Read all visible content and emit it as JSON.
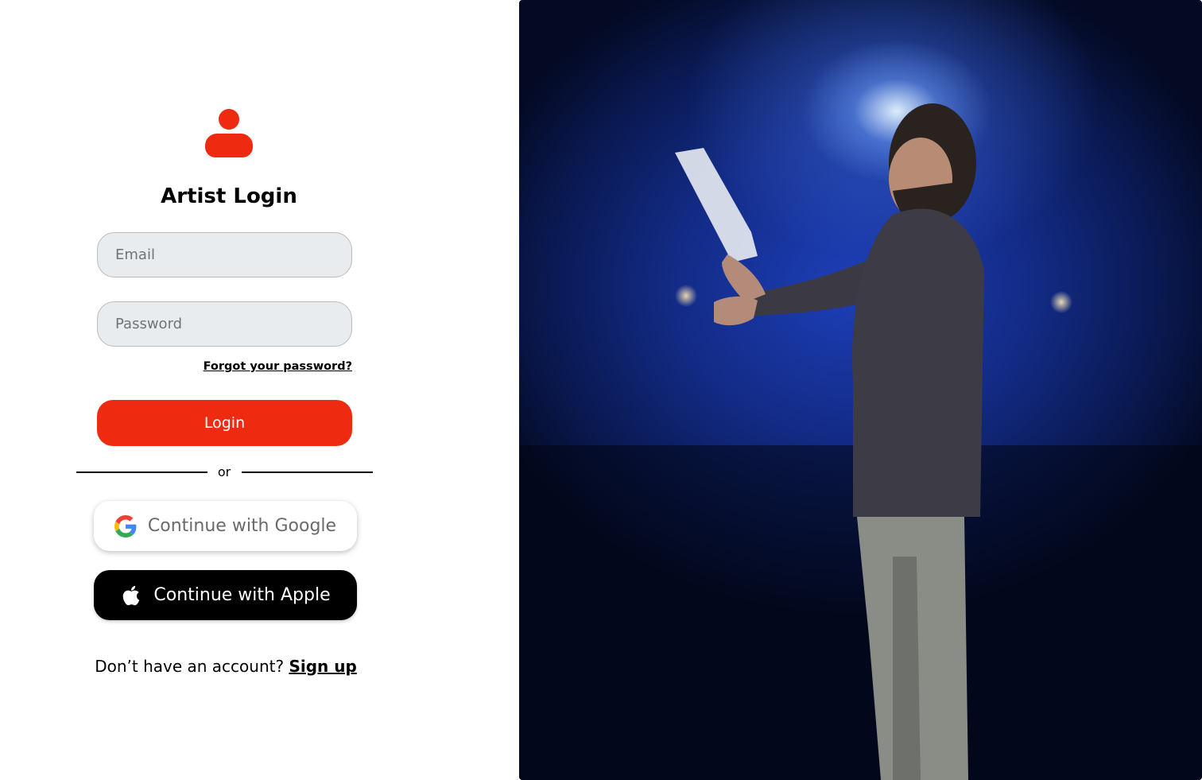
{
  "colors": {
    "accent": "#ee2a11",
    "apple_button_bg": "#000000",
    "field_bg": "#e9ecee"
  },
  "login": {
    "title": "Artist Login",
    "email_placeholder": "Email",
    "password_placeholder": "Password",
    "forgot_label": "Forgot your password?",
    "login_label": "Login",
    "divider_label": "or",
    "google_label": "Continue with Google",
    "apple_label": "Continue with Apple",
    "signup_prompt": "Don’t have an account?",
    "signup_label": "Sign up"
  },
  "icons": {
    "user": "user-icon",
    "google": "google-icon",
    "apple": "apple-icon"
  }
}
